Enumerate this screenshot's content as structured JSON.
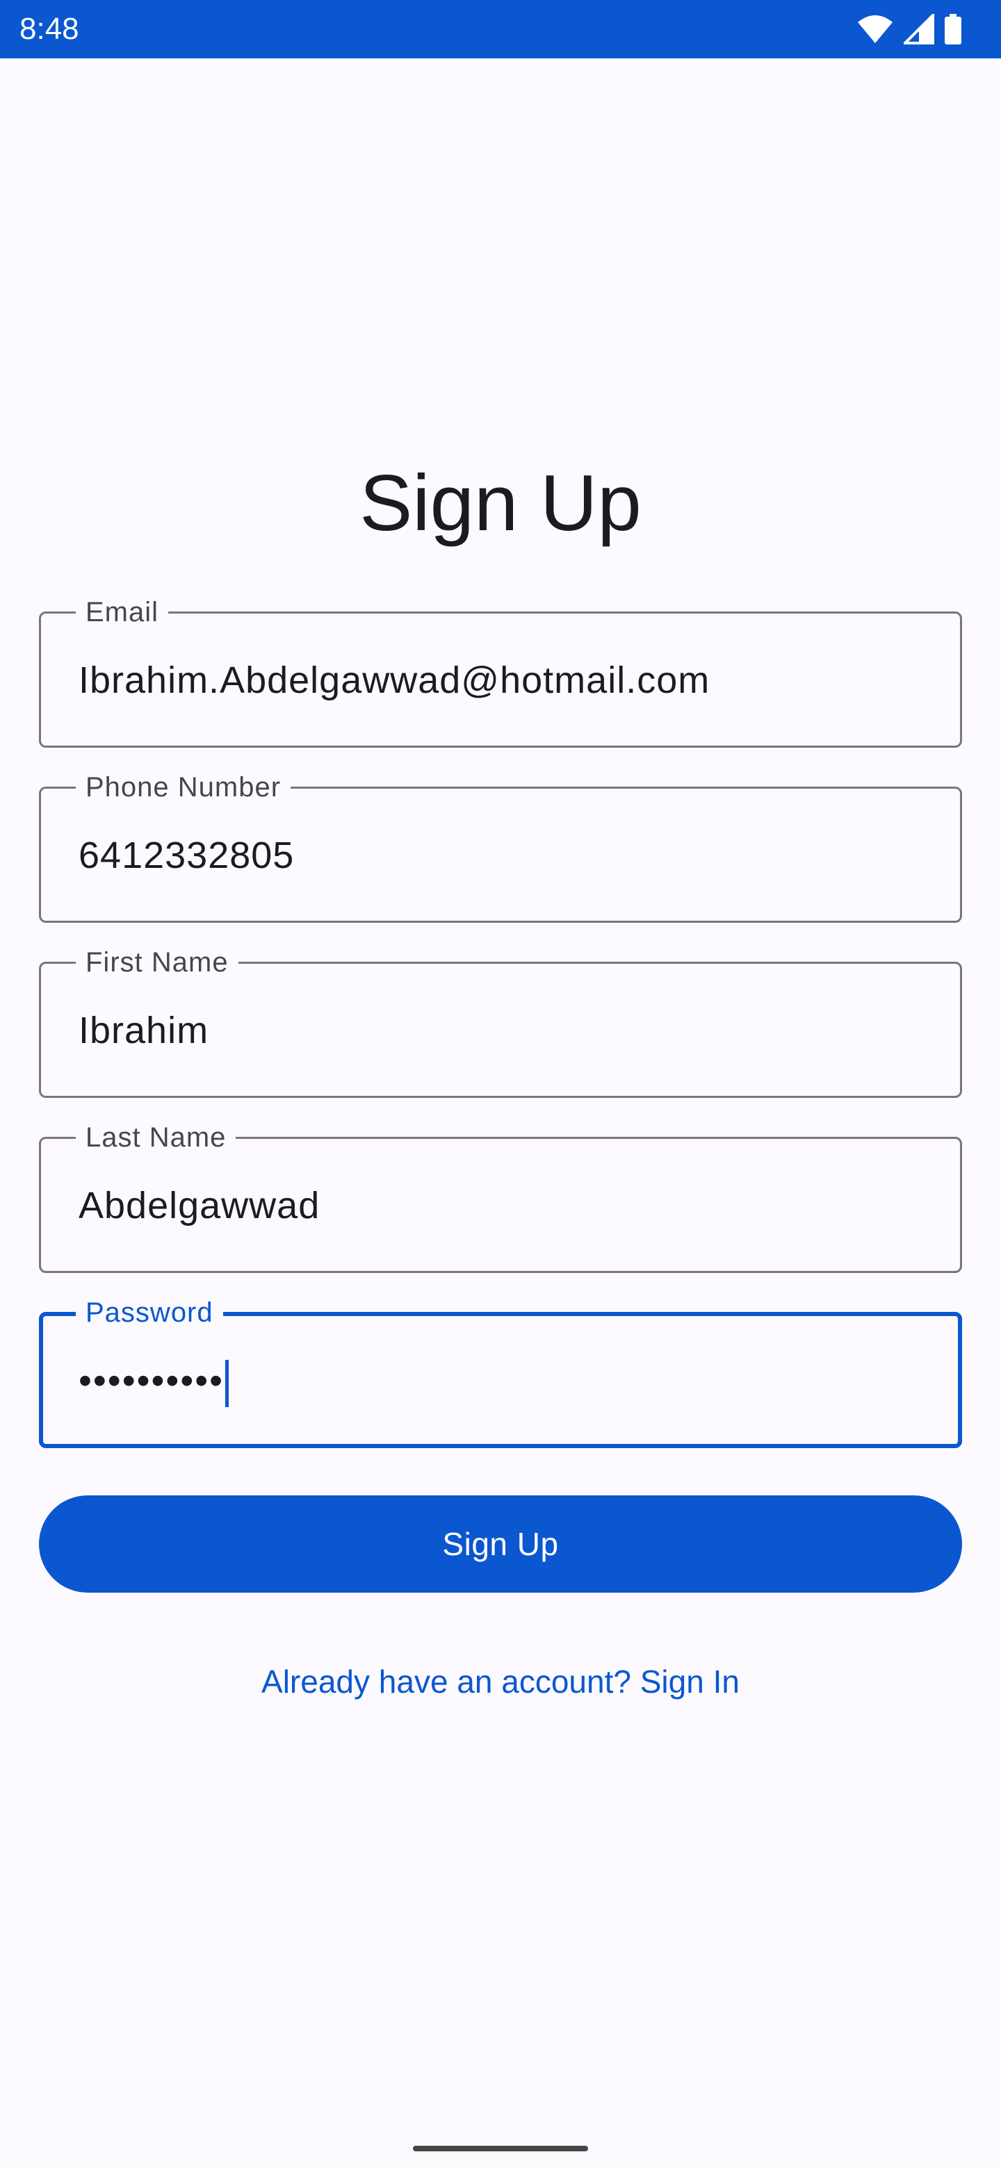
{
  "status_bar": {
    "time": "8:48",
    "icons": [
      "wifi-icon",
      "cell-signal-icon",
      "battery-icon"
    ],
    "background": "#0B57D0"
  },
  "screen": {
    "title": "Sign Up"
  },
  "form": {
    "fields": [
      {
        "label": "Email",
        "value": "Ibrahim.Abdelgawwad@hotmail.com"
      },
      {
        "label": "Phone Number",
        "value": "6412332805"
      },
      {
        "label": "First Name",
        "value": "Ibrahim"
      },
      {
        "label": "Last Name",
        "value": "Abdelgawwad"
      },
      {
        "label": "Password",
        "value": "••••••••••",
        "focused": true
      }
    ],
    "submit_label": "Sign Up",
    "signin_link": "Already have an account? Sign In"
  },
  "colors": {
    "accent": "#0B57D0",
    "background": "#FCFAFE",
    "outline": "#79747E"
  }
}
